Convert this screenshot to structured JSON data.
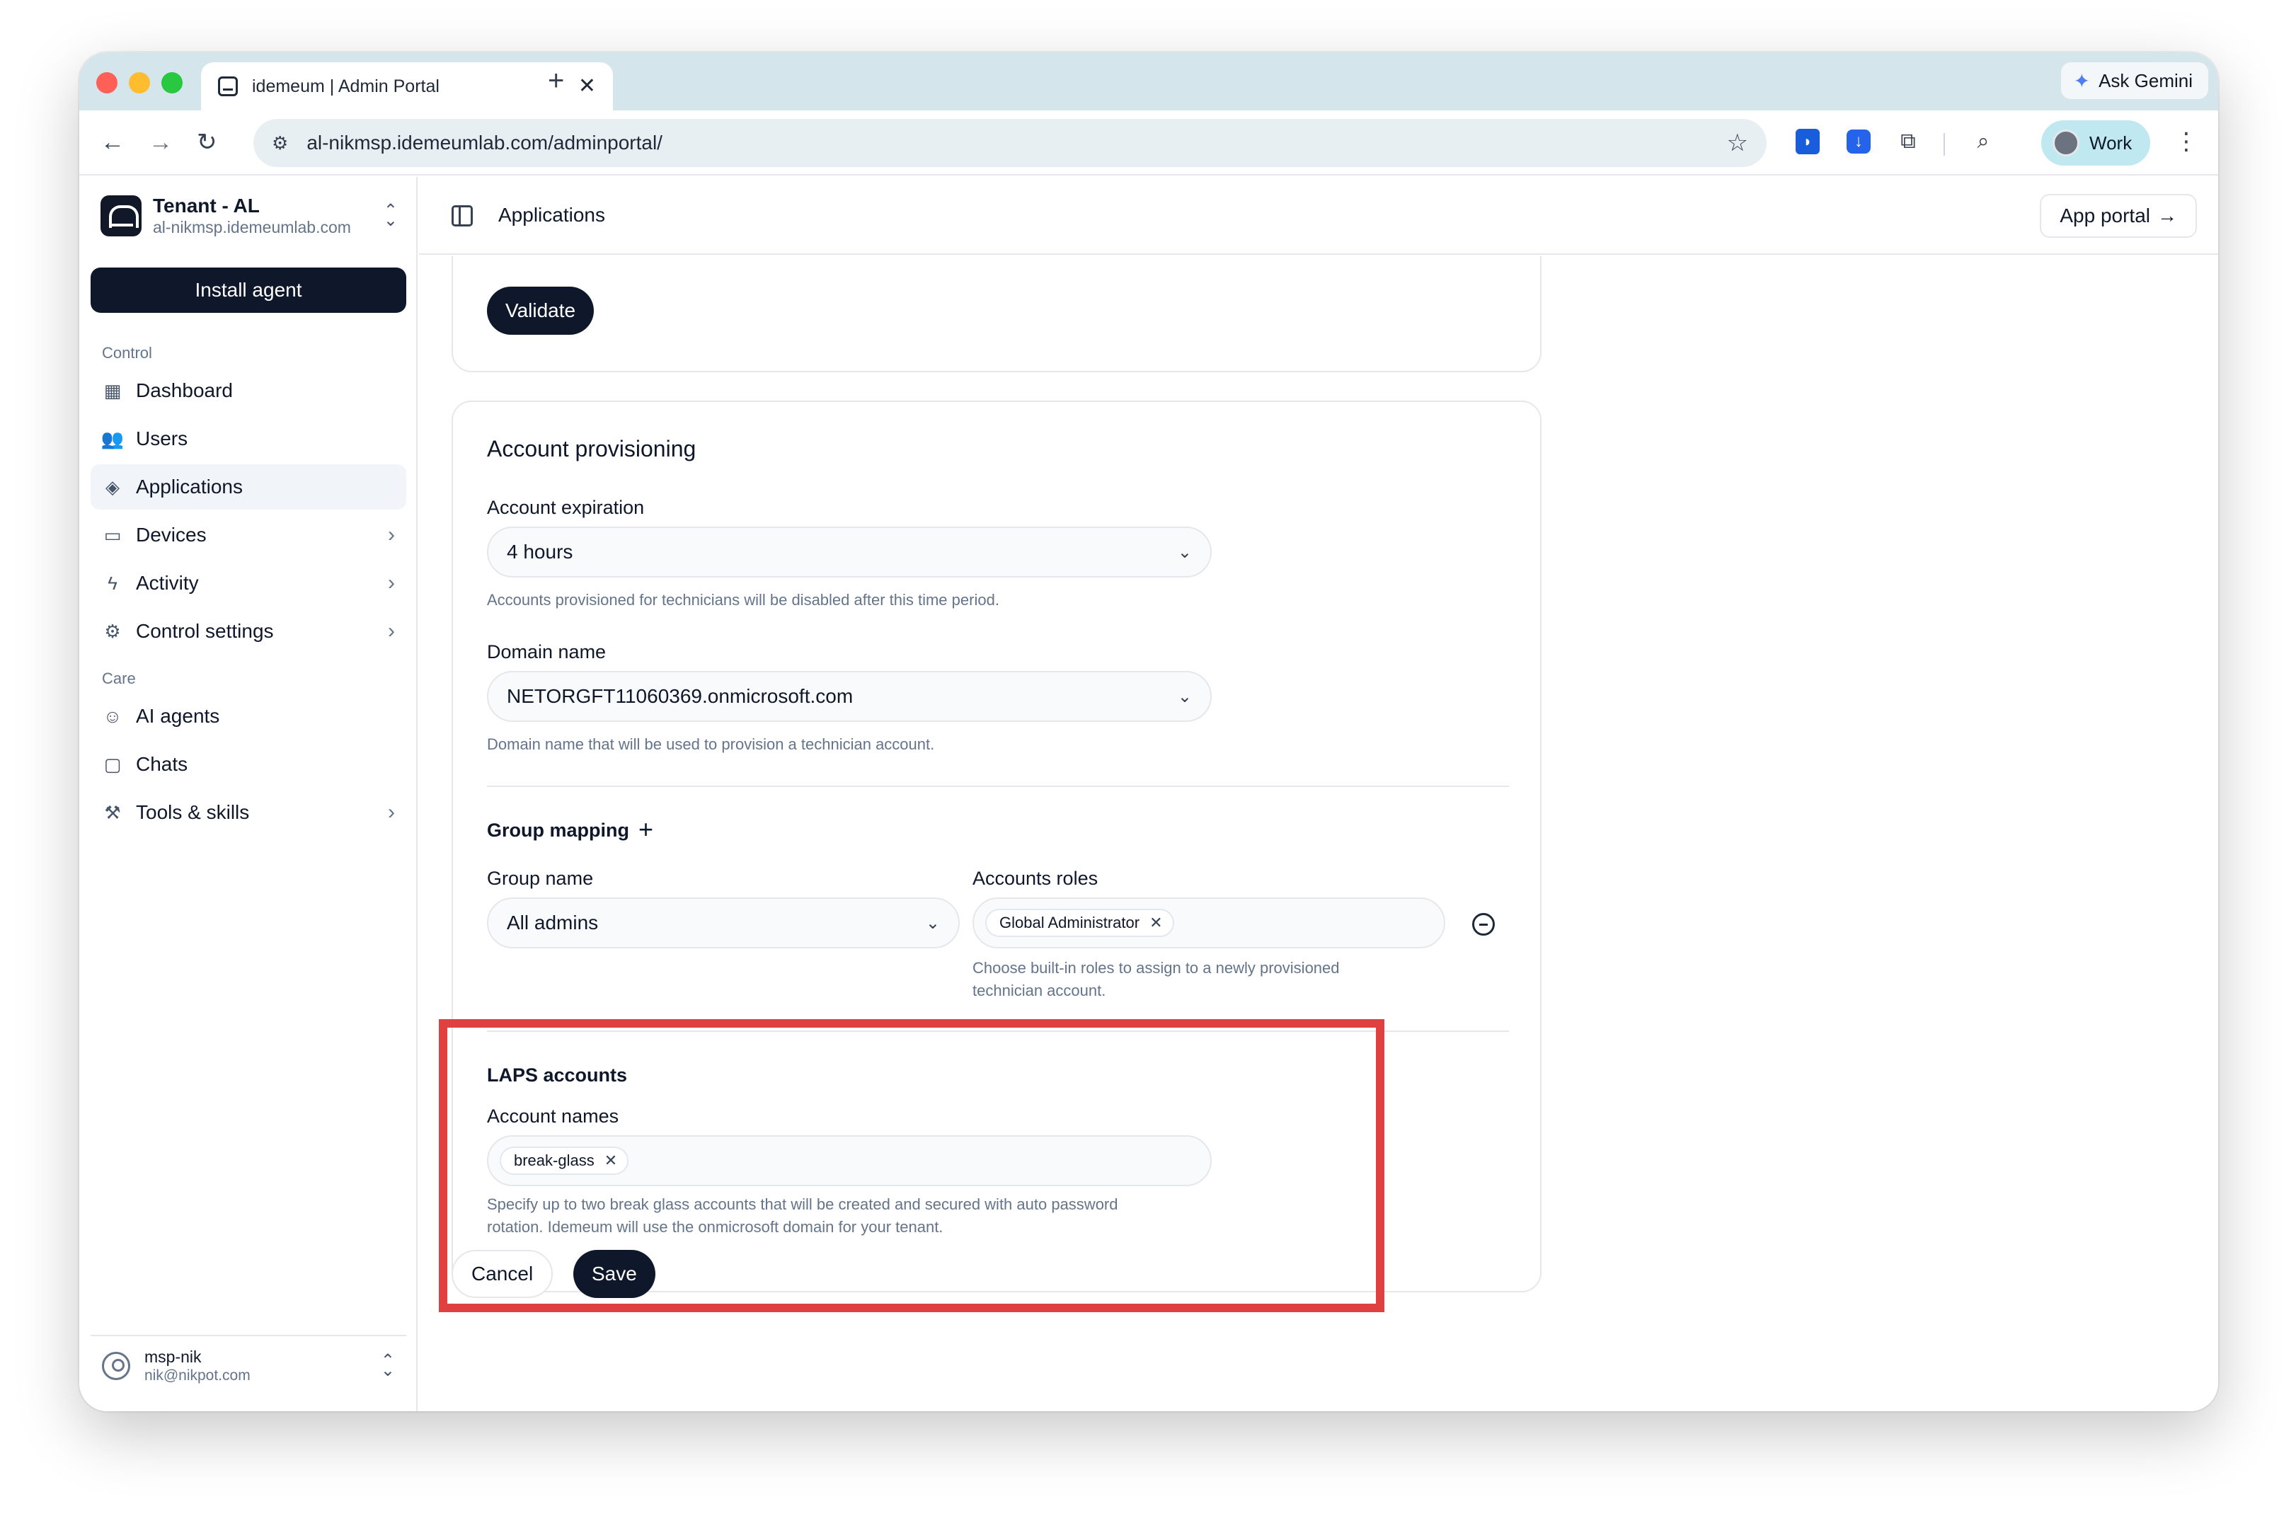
{
  "browser": {
    "tab_title": "idemeum | Admin Portal",
    "tab_close": "✕",
    "new_tab": "+",
    "ask_gemini": "Ask Gemini",
    "url": "al-nikmsp.idemeumlab.com/adminportal/",
    "profile_label": "Work"
  },
  "sidebar": {
    "tenant_name": "Tenant - AL",
    "tenant_domain": "al-nikmsp.idemeumlab.com",
    "install_agent": "Install agent",
    "section_control": "Control",
    "section_care": "Care",
    "control_items": [
      {
        "label": "Dashboard",
        "icon": "dashboard-icon",
        "has_chevron": false
      },
      {
        "label": "Users",
        "icon": "users-icon",
        "has_chevron": false
      },
      {
        "label": "Applications",
        "icon": "layers-icon",
        "has_chevron": false,
        "active": true
      },
      {
        "label": "Devices",
        "icon": "monitor-icon",
        "has_chevron": true
      },
      {
        "label": "Activity",
        "icon": "activity-icon",
        "has_chevron": true
      },
      {
        "label": "Control settings",
        "icon": "gear-icon",
        "has_chevron": true
      }
    ],
    "care_items": [
      {
        "label": "AI agents",
        "icon": "bot-icon",
        "has_chevron": false
      },
      {
        "label": "Chats",
        "icon": "chat-icon",
        "has_chevron": false
      },
      {
        "label": "Tools & skills",
        "icon": "wrench-icon",
        "has_chevron": true
      }
    ],
    "user_name": "msp-nik",
    "user_email": "nik@nikpot.com"
  },
  "header": {
    "title": "Applications",
    "app_portal": "App portal"
  },
  "form": {
    "validate": "Validate",
    "provisioning_title": "Account provisioning",
    "expiration_label": "Account expiration",
    "expiration_value": "4 hours",
    "expiration_help": "Accounts provisioned for technicians will be disabled after this time period.",
    "domain_label": "Domain name",
    "domain_value": "NETORGFT11060369.onmicrosoft.com",
    "domain_help": "Domain name that will be used to provision a technician account.",
    "group_mapping_label": "Group mapping",
    "group_name_label": "Group name",
    "group_name_value": "All admins",
    "roles_label": "Accounts roles",
    "role_chip": "Global Administrator",
    "roles_help_1": "Choose built-in roles to assign to a newly provisioned",
    "roles_help_2": "technician account.",
    "laps_title": "LAPS accounts",
    "account_names_label": "Account names",
    "account_chip": "break-glass",
    "laps_help_1": "Specify up to two break glass accounts that will be created and secured with auto password",
    "laps_help_2": "rotation. Idemeum will use the onmicrosoft domain for your tenant.",
    "cancel": "Cancel",
    "save": "Save"
  },
  "colors": {
    "highlight": "#e0403f",
    "primary": "#0f172a"
  }
}
